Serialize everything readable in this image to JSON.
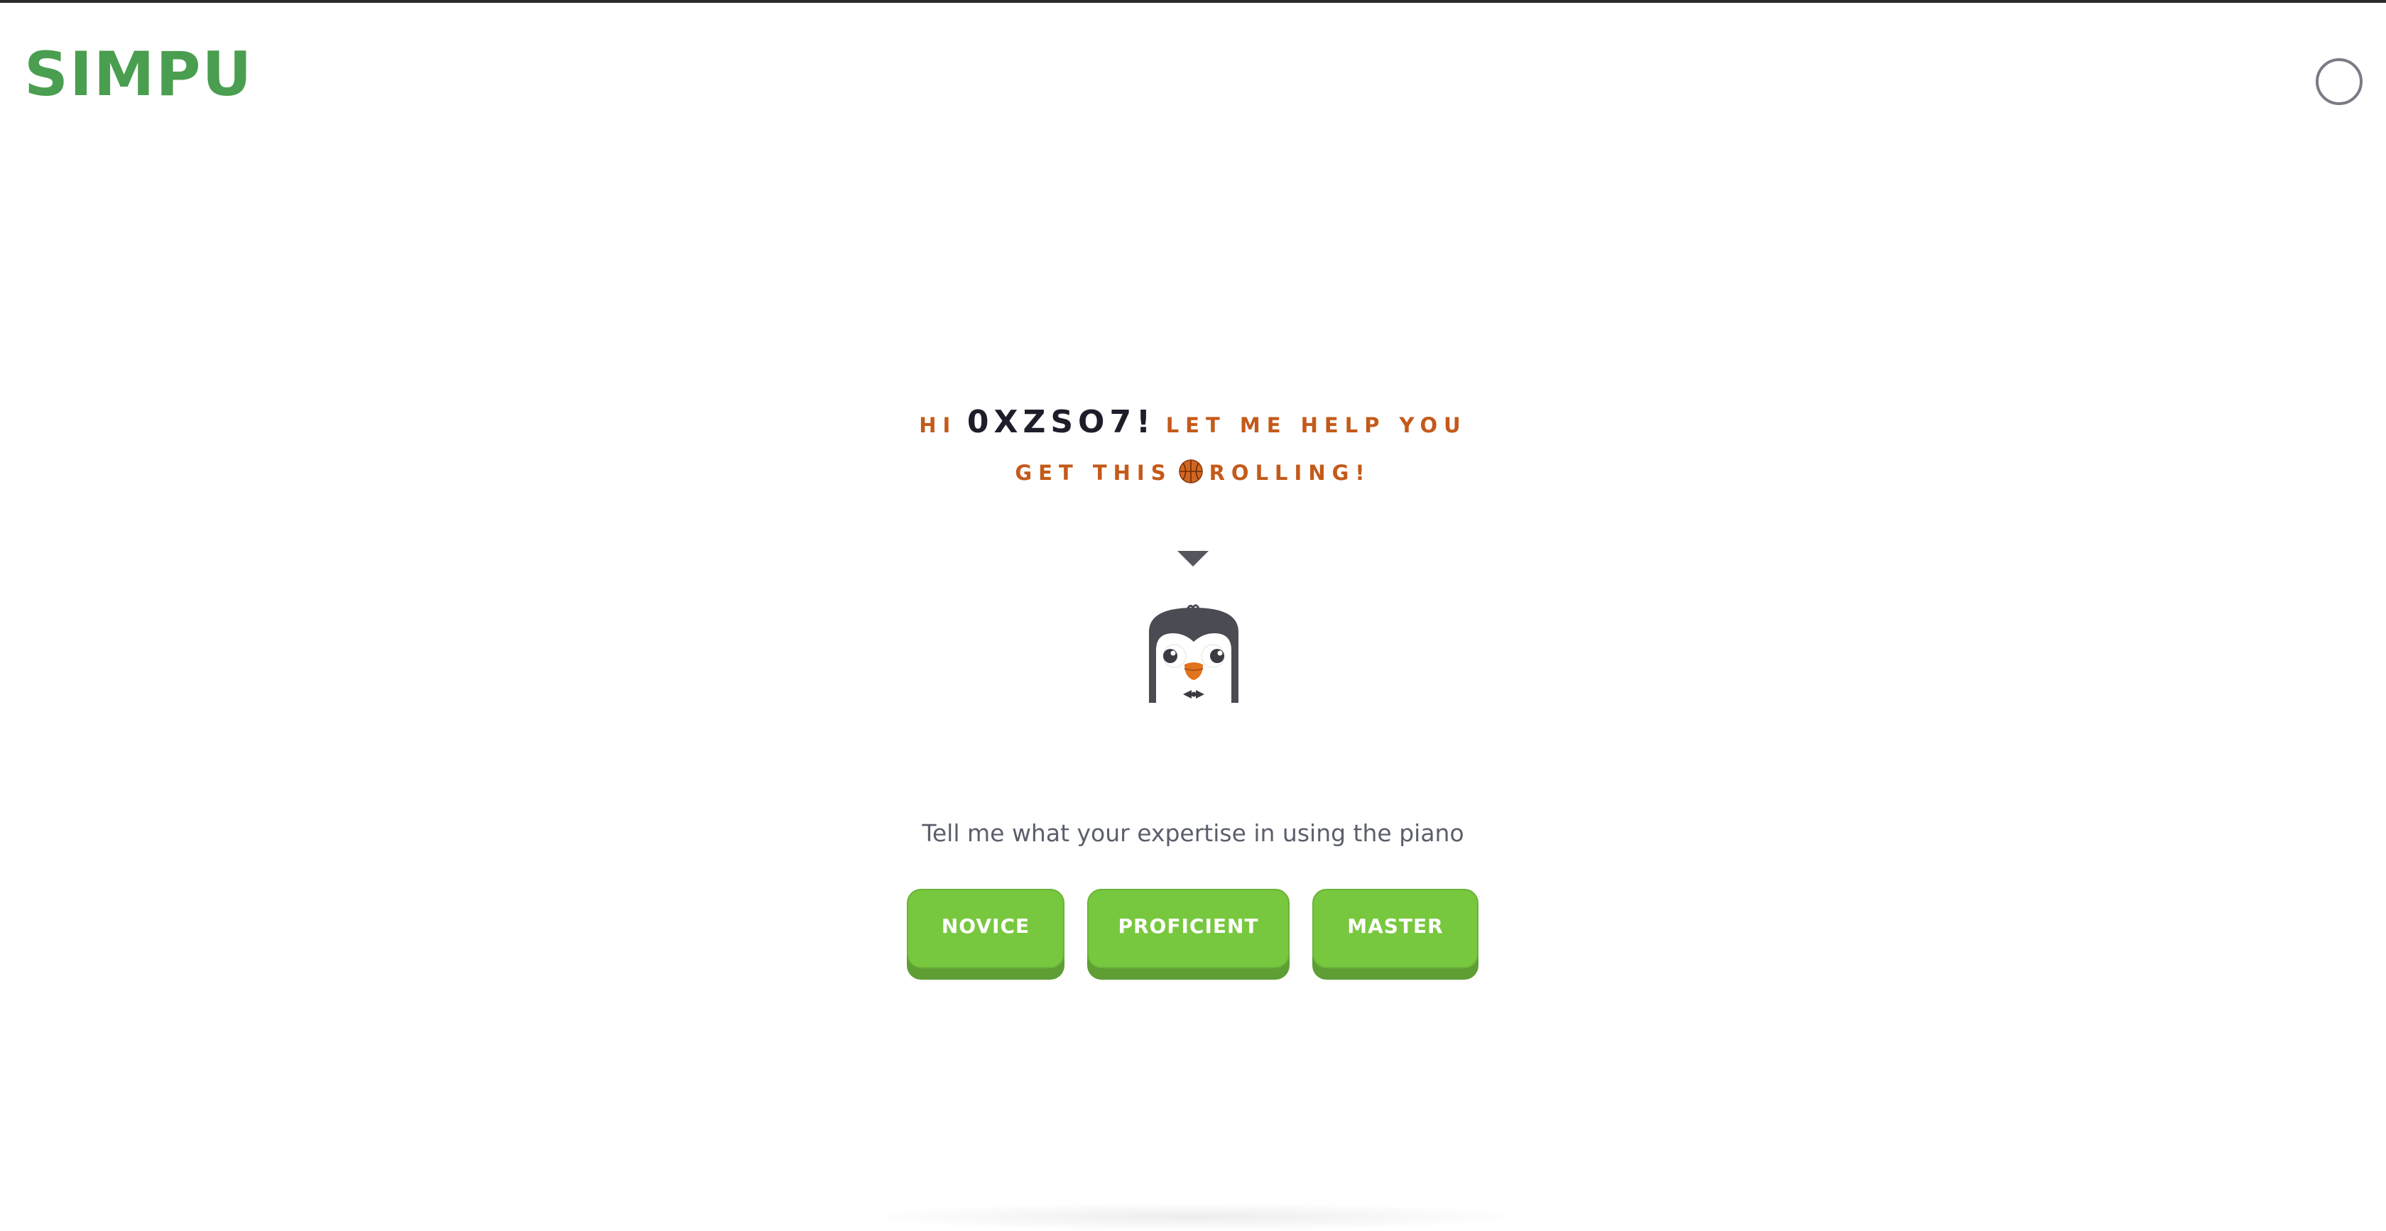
{
  "app": {
    "logo_text": "SIMPU"
  },
  "header": {
    "profile_icon": "profile-circle-icon"
  },
  "greeting": {
    "hi": "HI",
    "username": "0XZSO7!",
    "line1_rest": "LET ME HELP YOU",
    "line2_start": "GET THIS",
    "emoji_icon": "basketball-icon",
    "line2_end": "ROLLING!"
  },
  "mascot": {
    "icon": "penguin-mascot-icon"
  },
  "prompt": {
    "text": "Tell me what your expertise in using the piano"
  },
  "options": {
    "novice_label": "NOVICE",
    "proficient_label": "PROFICIENT",
    "master_label": "MASTER"
  },
  "colors": {
    "brand_green": "#4a9e4f",
    "button_green": "#78c83f",
    "button_shadow": "#5e9e35",
    "greeting_orange": "#c45a1a",
    "username_dark": "#1e1e2a"
  }
}
